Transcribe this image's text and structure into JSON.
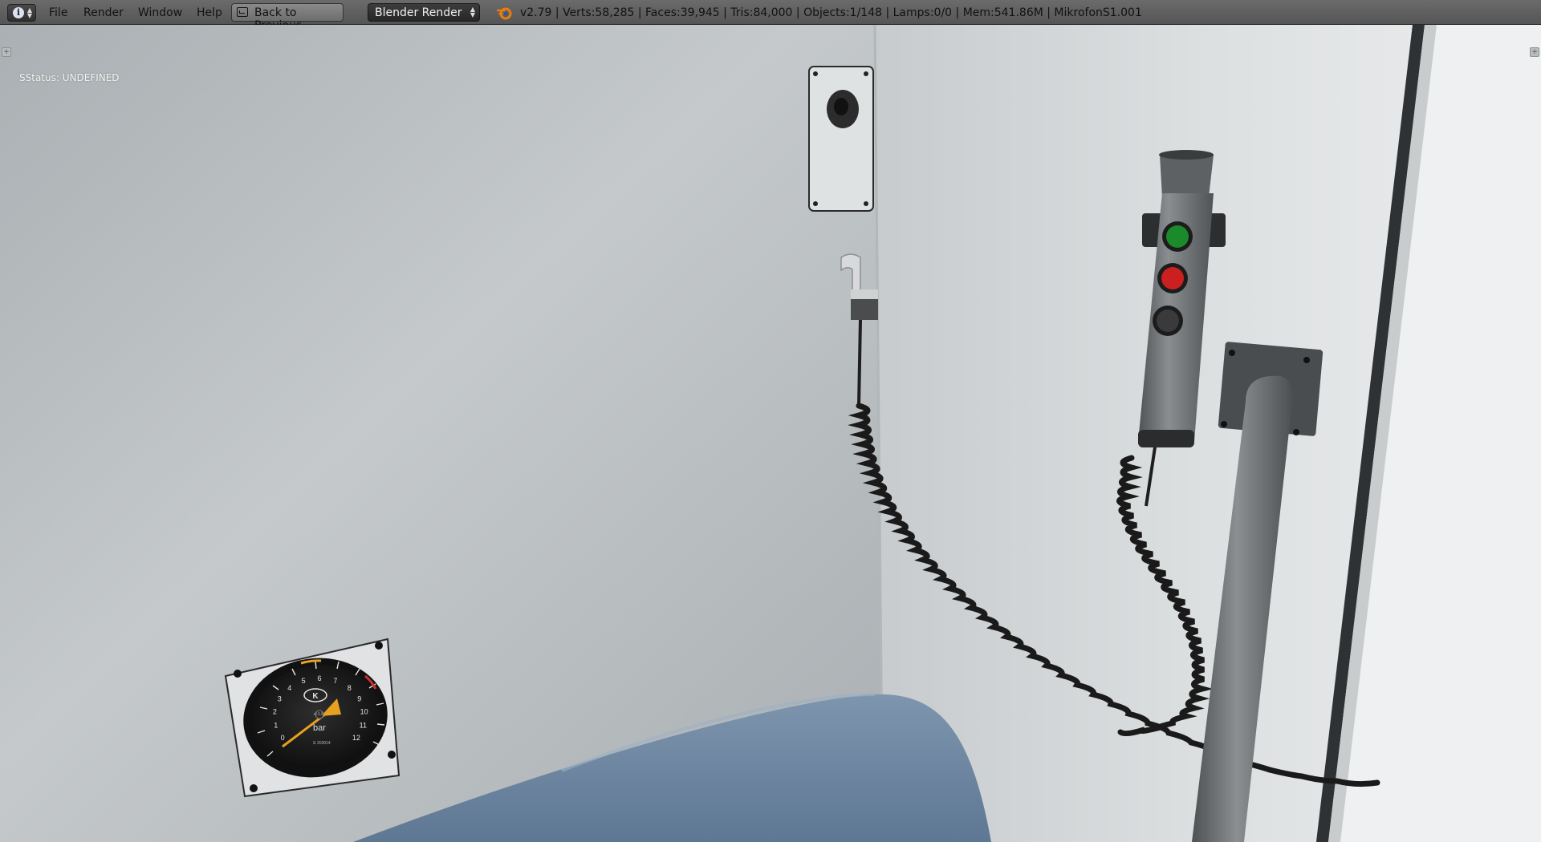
{
  "header": {
    "editor_icon": "info-icon",
    "menus": [
      "File",
      "Render",
      "Window",
      "Help"
    ],
    "back_button_label": "Back to Previous",
    "render_engine": "Blender Render",
    "stats": "v2.79 | Verts:58,285 | Faces:39,945 | Tris:84,000 | Objects:1/148 | Lamps:0/0 | Mem:541.86M | MikrofonS1.001"
  },
  "viewport": {
    "status_text": "SStatus: UNDEFINED",
    "gauge": {
      "unit": "bar",
      "brand_mark": "K",
      "small_text_1": "cl.1.6",
      "small_text_2": "E 203014",
      "ticks": [
        "0",
        "1",
        "2",
        "3",
        "4",
        "5",
        "6",
        "7",
        "8",
        "9",
        "10",
        "11",
        "12"
      ]
    }
  },
  "colors": {
    "header_bg": "#5f5f5f",
    "wall": "#c8cccd",
    "seat": "#6f8aa8",
    "button_green": "#1a8a2a",
    "button_red": "#cc1f1f",
    "gauge_needle": "#e8a020"
  }
}
